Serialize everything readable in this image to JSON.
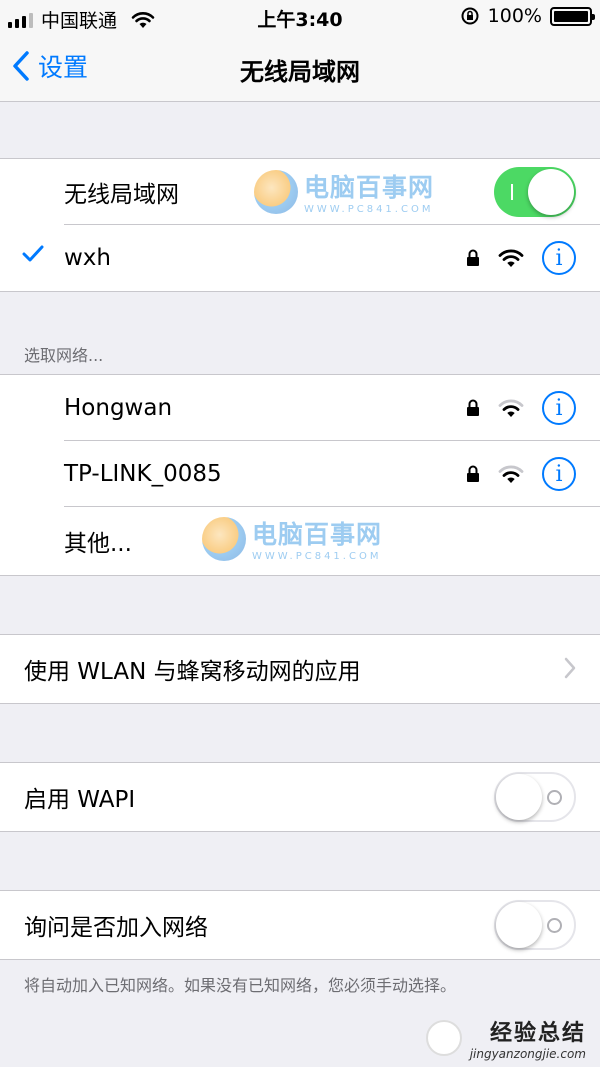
{
  "status_bar": {
    "carrier": "中国联通",
    "time": "上午3:40",
    "battery": "100%"
  },
  "nav": {
    "back_label": "设置",
    "title": "无线局域网"
  },
  "wifi_toggle_row": {
    "label": "无线局域网",
    "on": true
  },
  "connected": {
    "name": "wxh",
    "info": "i"
  },
  "choose_header": "选取网络...",
  "networks": [
    {
      "name": "Hongwan",
      "info": "i"
    },
    {
      "name": "TP-LINK_0085",
      "info": "i"
    }
  ],
  "other_label": "其他...",
  "apps_row": {
    "label": "使用 WLAN 与蜂窝移动网的应用"
  },
  "wapi_row": {
    "label": "启用 WAPI",
    "on": false
  },
  "ask_row": {
    "label": "询问是否加入网络",
    "on": false
  },
  "footer_note": "将自动加入已知网络。如果没有已知网络，您必须手动选择。",
  "watermark": {
    "name": "电脑百事网",
    "url": "WWW.PC841.COM",
    "site2_name": "经验总结",
    "site2_url": "jingyanzongjie.com"
  },
  "colors": {
    "accent": "#007aff",
    "toggle_on": "#4cd964",
    "background": "#efeff4"
  }
}
